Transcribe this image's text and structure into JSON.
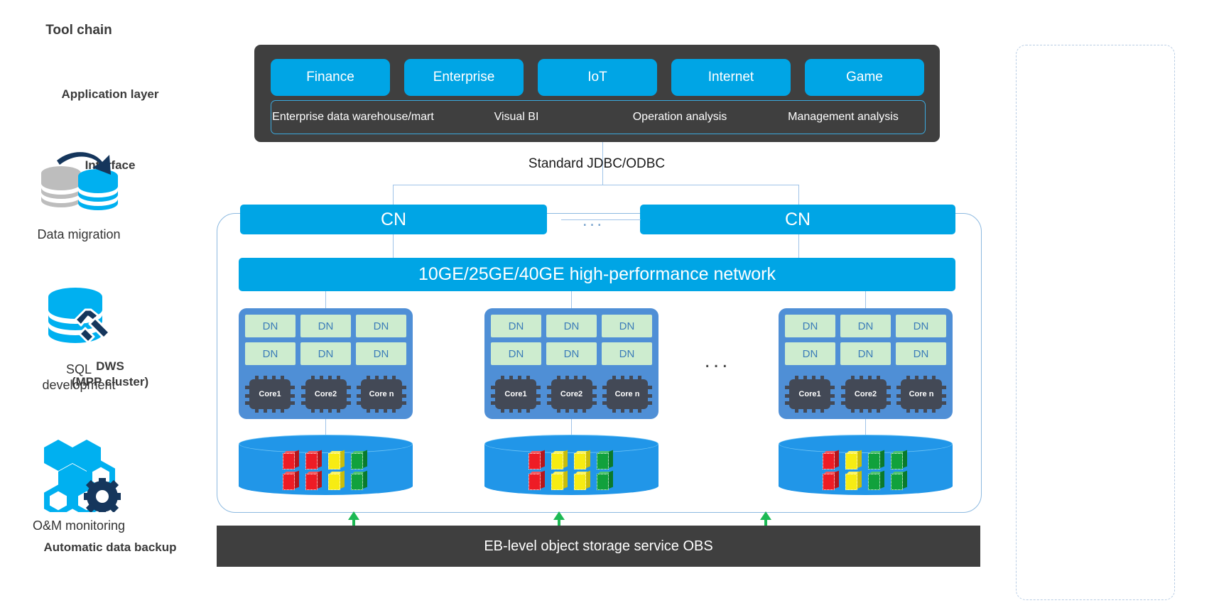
{
  "row_labels": [
    {
      "id": "application-layer",
      "text": "Application layer"
    },
    {
      "id": "interface",
      "text": "Interface"
    },
    {
      "id": "dws",
      "line1": "DWS",
      "line2": "(MPP cluster)"
    },
    {
      "id": "automatic-data-backup",
      "text": "Automatic data backup"
    }
  ],
  "application_layer": {
    "tabs": [
      {
        "label": "Finance"
      },
      {
        "label": "Enterprise"
      },
      {
        "label": "IoT"
      },
      {
        "label": "Internet"
      },
      {
        "label": "Game"
      }
    ],
    "subitems": [
      {
        "label": "Enterprise data warehouse/mart"
      },
      {
        "label": "Visual BI"
      },
      {
        "label": "Operation analysis"
      },
      {
        "label": "Management analysis"
      }
    ]
  },
  "interface": {
    "connector_label": "Standard JDBC/ODBC"
  },
  "cluster": {
    "cn_nodes": [
      {
        "label": "CN"
      },
      {
        "label": "CN"
      }
    ],
    "cn_ellipsis": "...",
    "network_bar": "10GE/25GE/40GE high-performance network",
    "group_ellipsis": "...",
    "node_groups": [
      {
        "dns": [
          "DN",
          "DN",
          "DN",
          "DN",
          "DN",
          "DN"
        ],
        "cores": [
          "Core1",
          "Core2",
          "Core n"
        ],
        "storage_blocks": [
          "red",
          "red",
          "yellow",
          "green",
          "red",
          "red",
          "yellow",
          "green"
        ]
      },
      {
        "dns": [
          "DN",
          "DN",
          "DN",
          "DN",
          "DN",
          "DN"
        ],
        "cores": [
          "Core1",
          "Core2",
          "Core n"
        ],
        "storage_blocks": [
          "red",
          "yellow",
          "yellow",
          "green",
          "red",
          "yellow",
          "yellow",
          "green"
        ]
      },
      {
        "dns": [
          "DN",
          "DN",
          "DN",
          "DN",
          "DN",
          "DN"
        ],
        "cores": [
          "Core1",
          "Core2",
          "Core n"
        ],
        "storage_blocks": [
          "red",
          "yellow",
          "green",
          "green",
          "red",
          "yellow",
          "green",
          "green"
        ]
      }
    ]
  },
  "storage": {
    "obs_label": "EB-level object storage service OBS"
  },
  "tool_chain": {
    "title": "Tool chain",
    "items": [
      {
        "icon": "data-migration-icon",
        "label": "Data migration"
      },
      {
        "icon": "sql-development-icon",
        "label_line1": "SQL",
        "label_line2": "development"
      },
      {
        "icon": "om-monitoring-icon",
        "label": "O&M monitoring"
      }
    ]
  },
  "colors": {
    "accent_blue": "#00a5e5",
    "panel_dark": "#3f3f3f",
    "node_group_blue": "#4f8fd6",
    "dn_green": "#cdeccf",
    "cylinder_blue": "#2196e8",
    "arrow_green": "#1db954",
    "block_red": "#ee1c25",
    "block_yellow": "#f7ec13",
    "block_green": "#11a13c",
    "navy": "#1b3a5c"
  }
}
